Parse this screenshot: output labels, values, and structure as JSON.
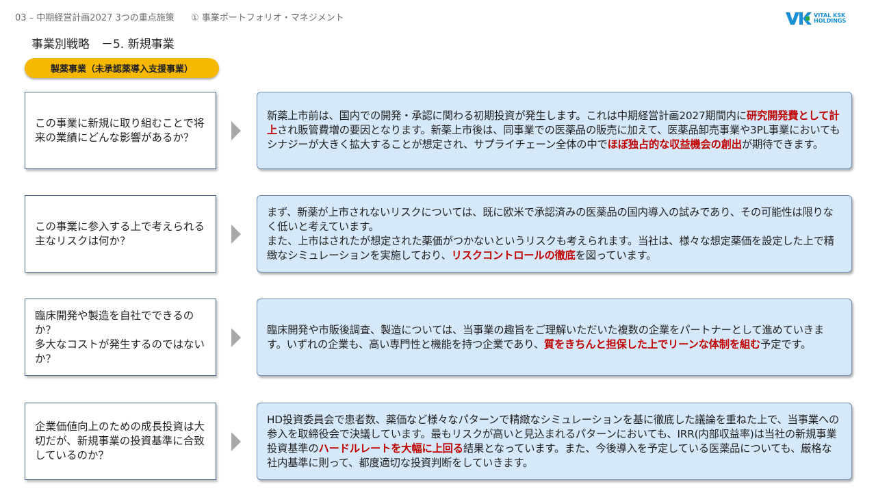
{
  "header": {
    "breadcrumb_section": "03 – 中期経営計画2027 3つの重点施策",
    "breadcrumb_sub": "① 事業ポートフォリオ・マネジメント",
    "logo_line1": "VITAL KSK",
    "logo_line2": "HOLDINGS"
  },
  "page": {
    "title": "事業別戦略　－5. 新規事業",
    "badge": "製薬事業（未承認薬導入支援事業）"
  },
  "rows": [
    {
      "question": "この事業に新規に取り組むことで将来の業績にどんな影響があるか？",
      "answer": [
        {
          "t": "新薬上市前は、国内での開発・承認に関わる初期投資が発生します。これは中期経営計画2027期間内に"
        },
        {
          "t": "研究開発費として計上",
          "h": true
        },
        {
          "t": "され販管費増の要因となります。新薬上市後は、同事業での医薬品の販売に加えて、医薬品卸売事業や3PL事業においてもシナジーが大きく拡大することが想定され、サプライチェーン全体の中で"
        },
        {
          "t": "ほぼ独占的な収益機会の創出",
          "h": true
        },
        {
          "t": "が期待できます。"
        }
      ]
    },
    {
      "question": "この事業に参入する上で考えられる主なリスクは何か？",
      "answer": [
        {
          "t": "まず、新薬が上市されないリスクについては、既に欧米で承認済みの医薬品の国内導入の試みであり、その可能性は限りなく低いと考えています。\nまた、上市はされたが想定された薬価がつかないというリスクも考えられます。当社は、様々な想定薬価を設定した上で精緻なシミュレーションを実施しており、"
        },
        {
          "t": "リスクコントロールの徹底",
          "h": true
        },
        {
          "t": "を図っています。"
        }
      ]
    },
    {
      "question": "臨床開発や製造を自社でできるのか？\n多大なコストが発生するのではないか？",
      "answer": [
        {
          "t": "臨床開発や市販後調査、製造については、当事業の趣旨をご理解いただいた複数の企業をパートナーとして進めていきます。いずれの企業も、高い専門性と機能を持つ企業であり、"
        },
        {
          "t": "質をきちんと担保した上でリーンな体制を組む",
          "h": true
        },
        {
          "t": "予定です。"
        }
      ]
    },
    {
      "question": "企業価値向上のための成長投資は大切だが、新規事業の投資基準に合致しているのか？",
      "answer": [
        {
          "t": "HD投資委員会で患者数、薬価など様々なパターンで精緻なシミュレーションを基に徹底した議論を重ねた上で、当事業への参入を取締役会で決議しています。最もリスクが高いと見込まれるパターンにおいても、IRR(内部収益率)は当社の新規事業投資基準の"
        },
        {
          "t": "ハードルレートを大幅に上回る",
          "h": true
        },
        {
          "t": "結果となっています。また、今後導入を予定している医薬品についても、厳格な社内基準に則って、都度適切な投資判断をしていきます。"
        }
      ]
    }
  ],
  "colors": {
    "badge": "#f6b800",
    "answer_bg": "#d5e9fa",
    "highlight": "#c00000",
    "logo": "#1a8fd6"
  }
}
